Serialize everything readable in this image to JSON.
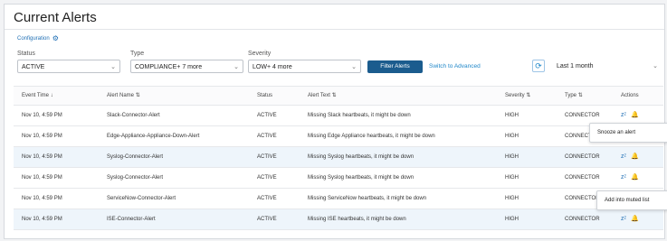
{
  "page": {
    "title": "Current Alerts",
    "config_link": "Configuration"
  },
  "filters": {
    "status": {
      "label": "Status",
      "value": "ACTIVE"
    },
    "type": {
      "label": "Type",
      "value": "COMPLIANCE+ 7 more"
    },
    "severity": {
      "label": "Severity",
      "value": "LOW+ 4 more"
    },
    "filter_button": "Filter Alerts",
    "switch_link": "Switch to Advanced",
    "time_range": "Last 1 month"
  },
  "table": {
    "headers": {
      "time": "Event Time",
      "name": "Alert Name",
      "status": "Status",
      "text": "Alert Text",
      "severity": "Severity",
      "type": "Type",
      "actions": "Actions"
    },
    "rows": [
      {
        "time": "Nov 10, 4:59 PM",
        "name": "Slack-Connector-Alert",
        "status": "ACTIVE",
        "text": "Missing Slack heartbeats, it might be down",
        "severity": "HIGH",
        "type": "CONNECTOR"
      },
      {
        "time": "Nov 10, 4:59 PM",
        "name": "Edge-Appliance-Appliance-Down-Alert",
        "status": "ACTIVE",
        "text": "Missing Edge Appliance heartbeats, it might be down",
        "severity": "HIGH",
        "type": "CONNECTOR"
      },
      {
        "time": "Nov 10, 4:59 PM",
        "name": "Syslog-Connector-Alert",
        "status": "ACTIVE",
        "text": "Missing Syslog heartbeats, it might be down",
        "severity": "HIGH",
        "type": "CONNECTOR"
      },
      {
        "time": "Nov 10, 4:59 PM",
        "name": "Syslog-Connector-Alert",
        "status": "ACTIVE",
        "text": "Missing Syslog heartbeats, it might be down",
        "severity": "HIGH",
        "type": "CONNECTOR"
      },
      {
        "time": "Nov 10, 4:59 PM",
        "name": "ServiceNow-Connector-Alert",
        "status": "ACTIVE",
        "text": "Missing ServiceNow heartbeats, it might be down",
        "severity": "HIGH",
        "type": "CONNECTOR"
      },
      {
        "time": "Nov 10, 4:59 PM",
        "name": "ISE-Connector-Alert",
        "status": "ACTIVE",
        "text": "Missing ISE heartbeats, it might be down",
        "severity": "HIGH",
        "type": "CONNECTOR"
      }
    ]
  },
  "tooltips": {
    "snooze": "Snooze an alert",
    "mute": "Add into muted list"
  },
  "icons": {
    "config": "gear-icon",
    "refresh": "refresh-icon",
    "snooze": "snooze-icon",
    "mute": "bell-icon",
    "dropdown": "chevron-down-icon",
    "sort": "sort-icon"
  }
}
